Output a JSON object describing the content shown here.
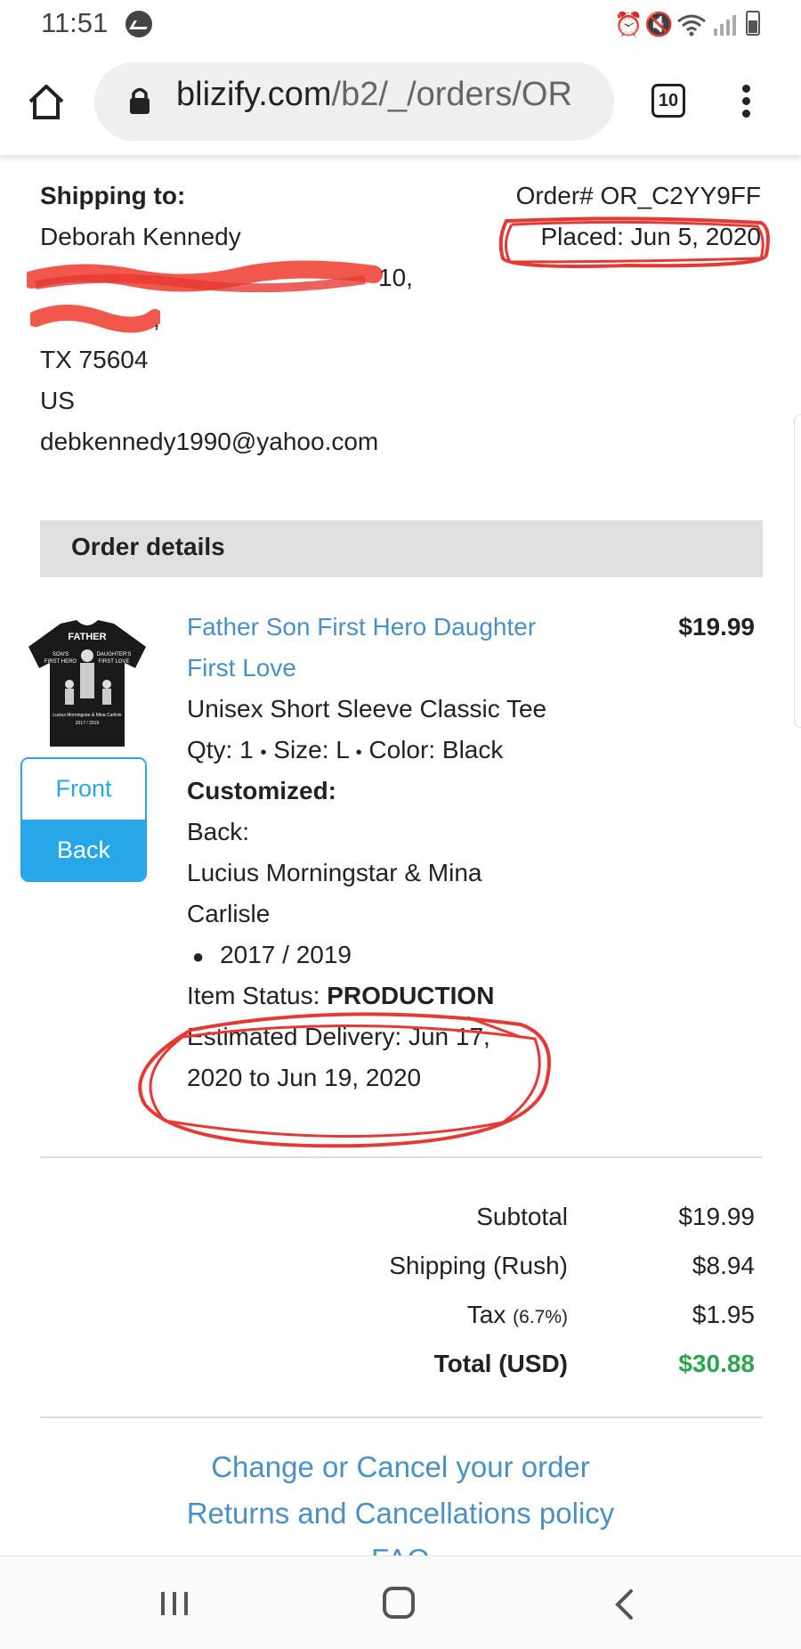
{
  "status_bar": {
    "time": "11:51"
  },
  "browser": {
    "url_domain": "blizify.com",
    "url_path": "/b2/_/orders/OR",
    "tab_count": "10",
    "icons": [
      "home-icon",
      "lock-icon",
      "tabs-icon",
      "menu-icon"
    ]
  },
  "shipping": {
    "heading": "Shipping to:",
    "name": "Deborah Kennedy",
    "address_suffix": "10,",
    "city_suffix": ",",
    "state_zip": "TX 75604",
    "country": "US",
    "email": "debkennedy1990@yahoo.com"
  },
  "order": {
    "number": "Order# OR_C2YY9FF",
    "placed": "Placed: Jun 5, 2020"
  },
  "order_details": {
    "heading": "Order details",
    "item": {
      "image_front_label": "Front",
      "image_back_label": "Back",
      "title_line1": "Father Son First Hero Daughter",
      "title_line2": "First Love",
      "price": "$19.99",
      "product_type": "Unisex Short Sleeve Classic Tee",
      "qty": "Qty: 1",
      "size": "Size: L",
      "color": "Color: Black",
      "customized_label": "Customized:",
      "custom_side": "Back:",
      "custom_names_line1": "Lucius Morningstar & Mina",
      "custom_names_line2": "Carlisle",
      "custom_years": "2017 / 2019",
      "status_label": "Item Status:",
      "status_value": "PRODUCTION",
      "delivery_line1": "Estimated Delivery: Jun 17,",
      "delivery_line2": "2020 to Jun 19, 2020",
      "shirt_print": {
        "top": "FATHER",
        "left": "SON'S FIRST HERO",
        "right": "DAUGHTER'S FIRST LOVE",
        "names": "Lucius Morningstar & Mina Carlisle"
      }
    }
  },
  "totals": {
    "subtotal_label": "Subtotal",
    "subtotal": "$19.99",
    "shipping_label": "Shipping (Rush)",
    "shipping": "$8.94",
    "tax_label": "Tax",
    "tax_rate": "(6.7%)",
    "tax": "$1.95",
    "total_label": "Total (USD)",
    "total": "$30.88",
    "total_color": "#2ea44f"
  },
  "links": {
    "change_cancel": "Change or Cancel your order",
    "returns_policy": "Returns and Cancellations policy",
    "faq": "FAQ"
  },
  "colors": {
    "accent": "#27a7e8",
    "link": "#4a90c4",
    "annotation": "#e53935"
  }
}
